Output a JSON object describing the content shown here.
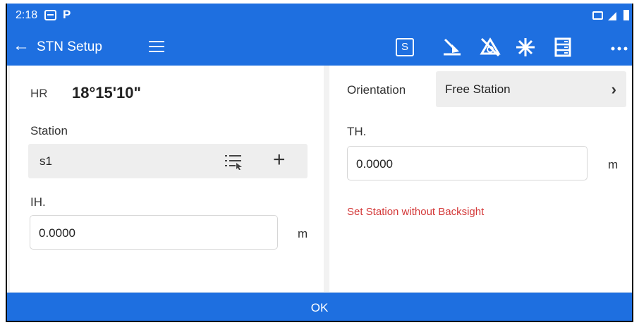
{
  "status_bar": {
    "time": "2:18",
    "notification_icons": [
      "photos-icon",
      "parking-icon"
    ],
    "system_icons": [
      "cast-icon",
      "signal-icon",
      "battery-icon"
    ],
    "p_glyph": "P"
  },
  "app_bar": {
    "title": "STN Setup",
    "s_button_label": "S",
    "actions": [
      "back-icon",
      "menu-icon",
      "s-mode-icon",
      "tilt-icon",
      "no-prism-icon",
      "laser-icon",
      "storage-icon",
      "more-icon"
    ],
    "color": "#1e6fe0"
  },
  "left_panel": {
    "hr_label": "HR",
    "hr_value": "18°15'10\"",
    "station_label": "Station",
    "station_value": "s1",
    "ih_label": "IH.",
    "ih_value": "0.0000",
    "ih_unit": "m"
  },
  "right_panel": {
    "orientation_label": "Orientation",
    "orientation_value": "Free Station",
    "th_label": "TH.",
    "th_value": "0.0000",
    "th_unit": "m",
    "warning": "Set Station without Backsight",
    "warning_color": "#d43a3a"
  },
  "footer": {
    "ok_label": "OK"
  }
}
